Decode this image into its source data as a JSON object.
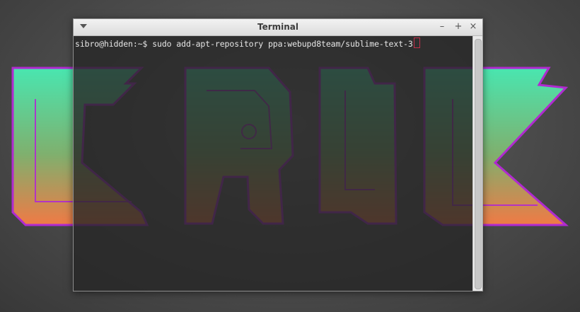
{
  "window": {
    "title": "Terminal",
    "menu_icon": "chevron-down-icon",
    "minimize_label": "–",
    "maximize_label": "+",
    "close_label": "×"
  },
  "terminal": {
    "prompt": "sibro@hidden:~$ ",
    "command": "sudo add-apt-repository ppa:webupd8team/sublime-text-3"
  },
  "colors": {
    "logo_top": "#49e6b0",
    "logo_bottom": "#f07a45",
    "logo_outline": "#b02ad0",
    "cursor": "#c0304a"
  }
}
